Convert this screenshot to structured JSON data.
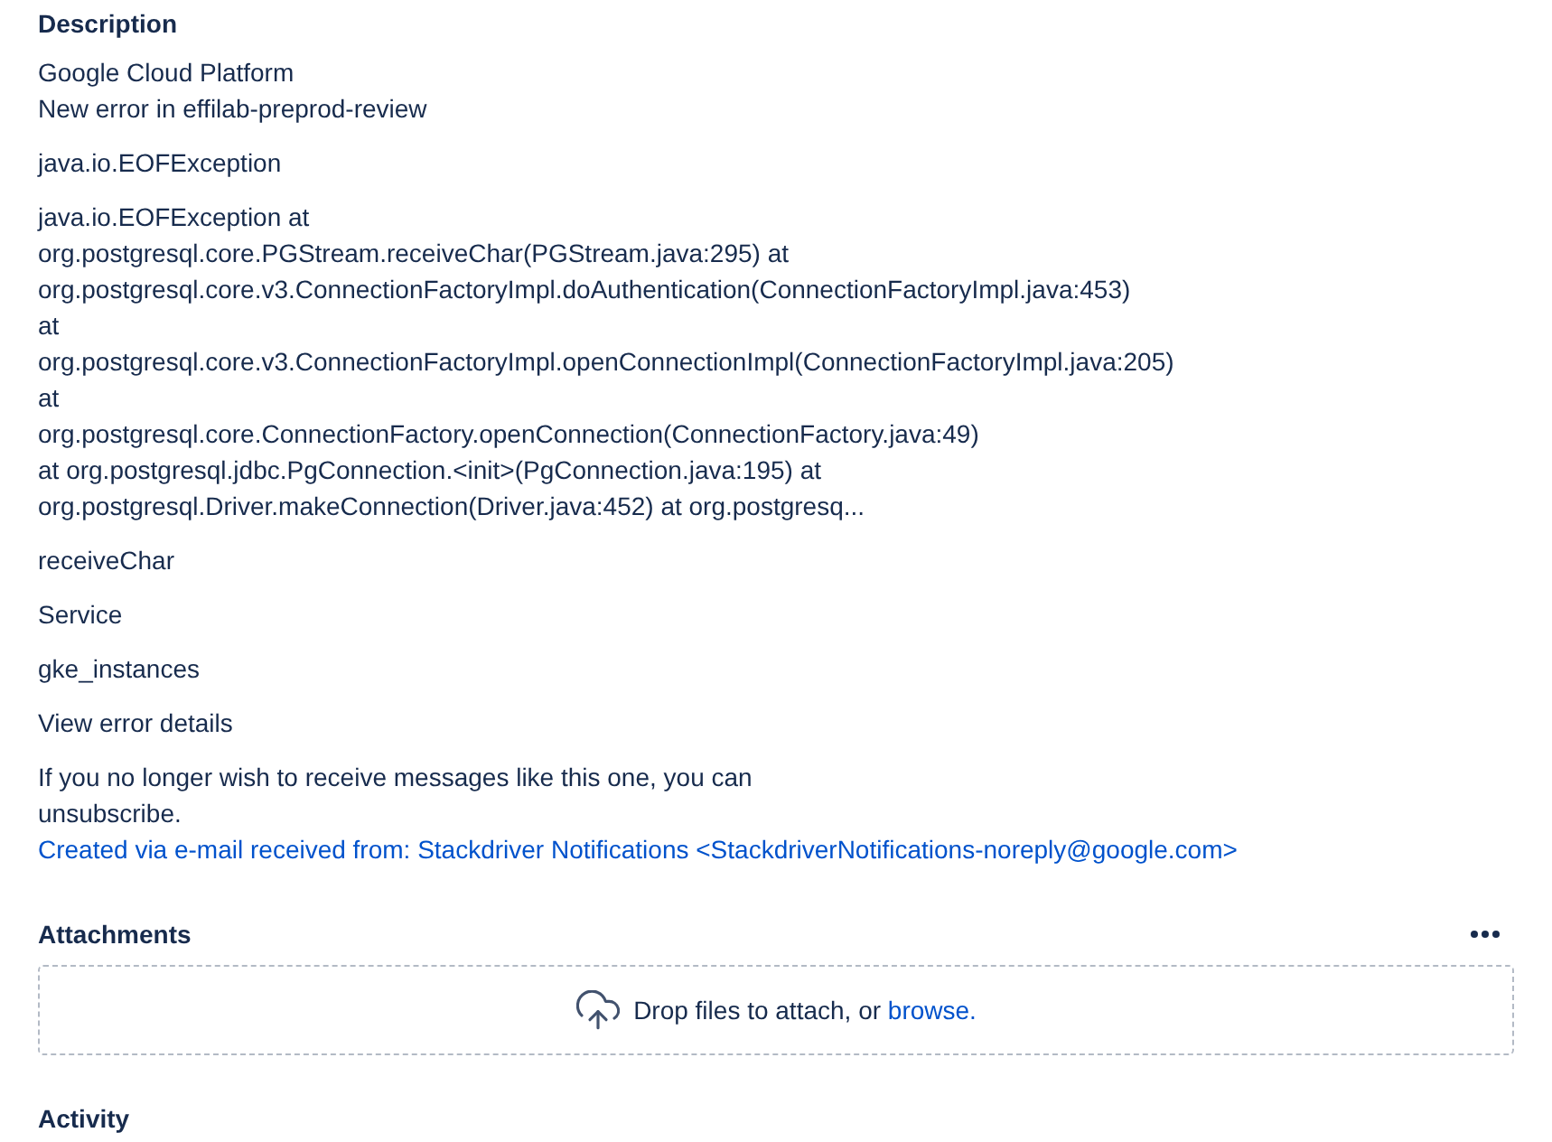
{
  "description": {
    "heading": "Description",
    "paragraphs": [
      {
        "items": [
          {
            "kind": "text",
            "lines": [
              "Google Cloud Platform",
              "New error in effilab-preprod-review"
            ]
          }
        ]
      },
      {
        "items": [
          {
            "kind": "text",
            "lines": [
              "java.io.EOFException"
            ]
          }
        ]
      },
      {
        "items": [
          {
            "kind": "text",
            "lines": [
              "java.io.EOFException at",
              "org.postgresql.core.PGStream.receiveChar(PGStream.java:295) at",
              "org.postgresql.core.v3.ConnectionFactoryImpl.doAuthentication(ConnectionFactoryImpl.java:453)",
              "at",
              "org.postgresql.core.v3.ConnectionFactoryImpl.openConnectionImpl(ConnectionFactoryImpl.java:205)",
              "at",
              "org.postgresql.core.ConnectionFactory.openConnection(ConnectionFactory.java:49)",
              "at org.postgresql.jdbc.PgConnection.<init>(PgConnection.java:195) at",
              "org.postgresql.Driver.makeConnection(Driver.java:452) at org.postgresq..."
            ]
          }
        ]
      },
      {
        "items": [
          {
            "kind": "text",
            "lines": [
              "receiveChar"
            ]
          }
        ]
      },
      {
        "items": [
          {
            "kind": "text",
            "lines": [
              "Service"
            ]
          }
        ]
      },
      {
        "items": [
          {
            "kind": "text",
            "lines": [
              "gke_instances"
            ]
          }
        ]
      },
      {
        "items": [
          {
            "kind": "text",
            "lines": [
              "View error details"
            ]
          }
        ]
      },
      {
        "items": [
          {
            "kind": "text",
            "lines": [
              "If you no longer wish to receive messages like this one, you can",
              "unsubscribe."
            ]
          },
          {
            "kind": "link",
            "lines": [
              "Created via e-mail received from: Stackdriver Notifications <StackdriverNotifications-noreply@google.com>"
            ]
          }
        ]
      }
    ]
  },
  "attachments": {
    "heading": "Attachments",
    "dropzone": {
      "text": "Drop files to attach, or ",
      "link": "browse."
    }
  },
  "activity": {
    "heading": "Activity"
  }
}
